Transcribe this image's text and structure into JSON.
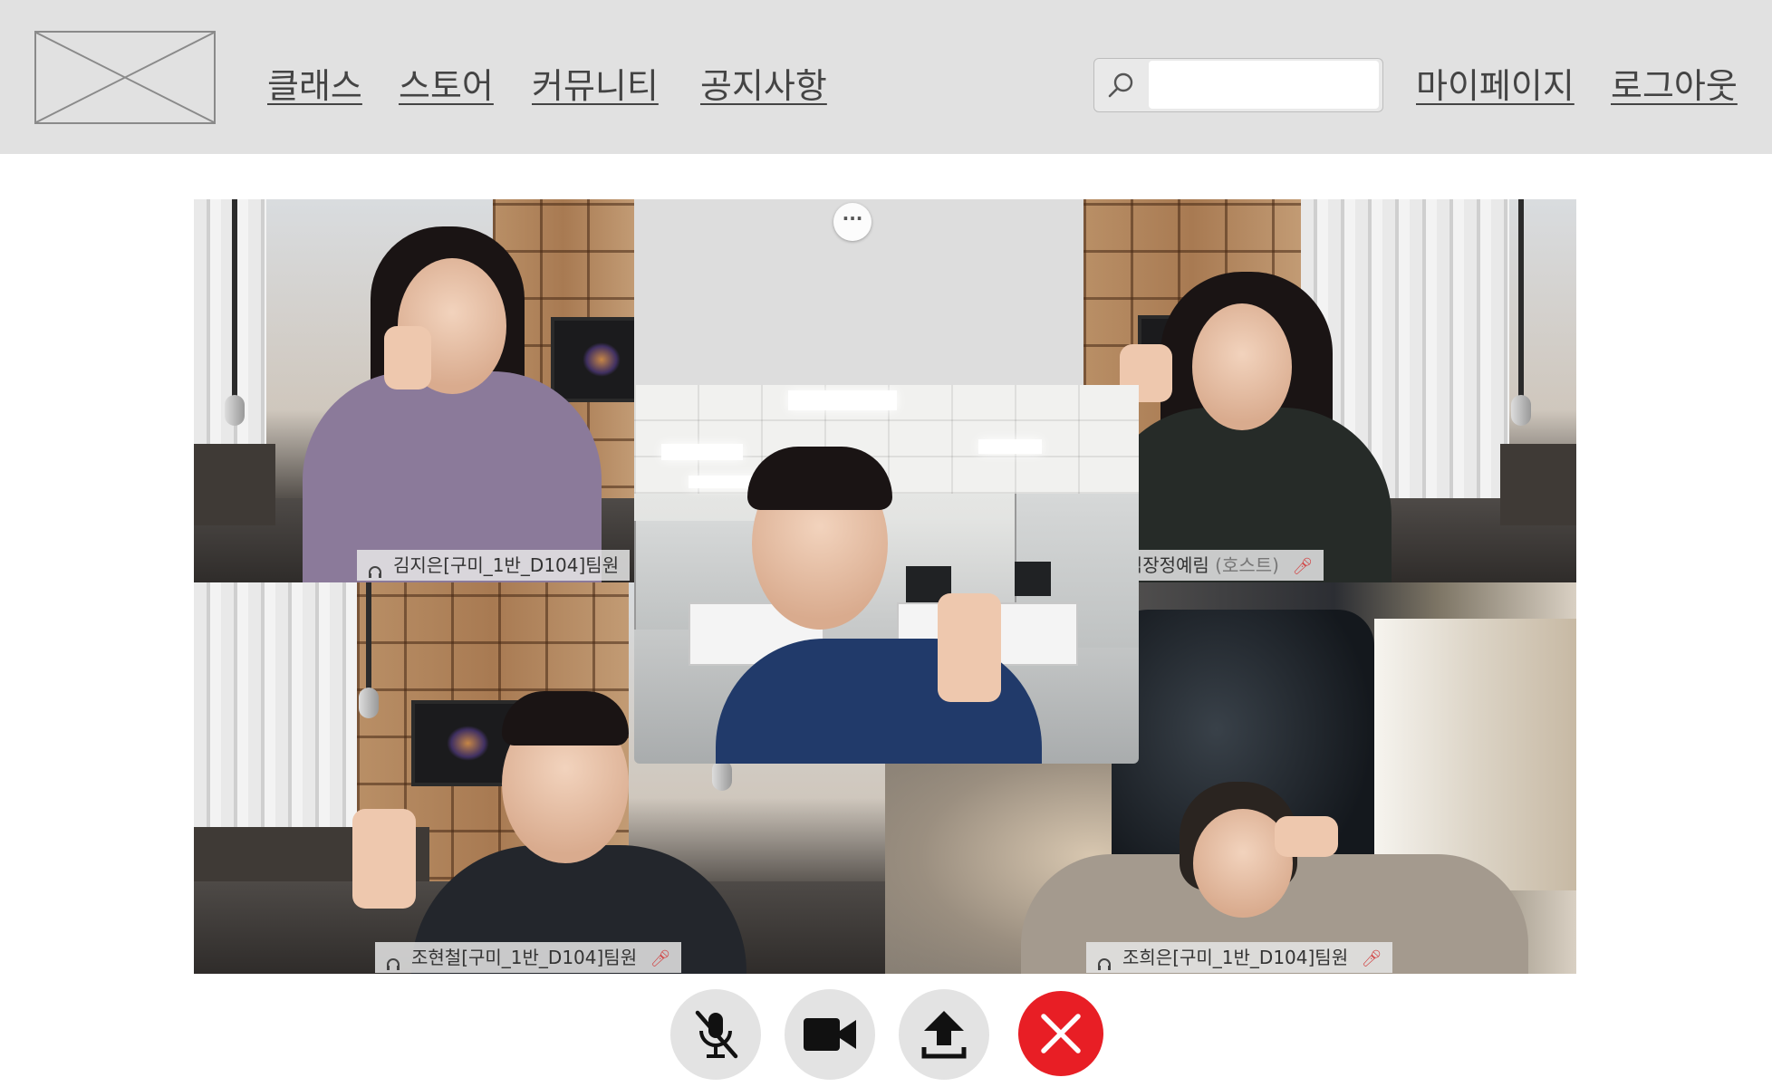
{
  "nav": {
    "items": [
      {
        "label": "클래스"
      },
      {
        "label": "스토어"
      },
      {
        "label": "커뮤니티"
      },
      {
        "label": "공지사항"
      }
    ],
    "mypage": "마이페이지",
    "logout": "로그아웃"
  },
  "search": {
    "placeholder": "",
    "icon": "search-icon"
  },
  "participants": [
    {
      "name": "김지은[구미_1반_D104]팀원",
      "host_tag": "",
      "mic_muted": false
    },
    {
      "name": "구미팀장정예림",
      "host_tag": "(호스트)",
      "mic_muted": true
    },
    {
      "name": "조현철[구미_1반_D104]팀원",
      "host_tag": "",
      "mic_muted": true
    },
    {
      "name": "조희은[구미_1반_D104]팀원",
      "host_tag": "",
      "mic_muted": true
    }
  ],
  "controls": {
    "mic": "mic-off-icon",
    "camera": "video-camera-icon",
    "share": "upload-icon",
    "leave": "close-icon",
    "leave_color": "#e81e25"
  }
}
